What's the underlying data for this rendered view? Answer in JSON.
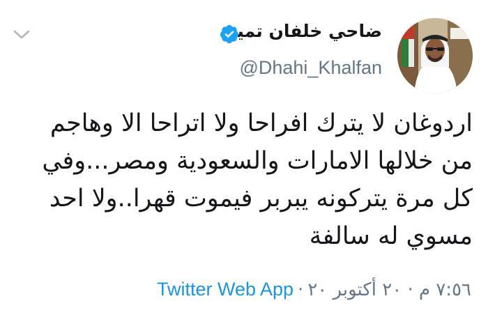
{
  "tweet": {
    "display_name": "ضاحي خلفان تميم",
    "handle": "@Dhahi_Khalfan",
    "text_lines": [
      "اردوغان لا يترك افراحا ولا اتراحا الا وهاجم",
      "من خلالها الامارات والسعودية ومصر...وفي",
      "كل مرة يتركونه يبربر فيموت قهرا..ولا احد",
      "مسوي له سالفة"
    ],
    "timestamp": "٧:٥٦ م · ٢٠ أكتوبر ٢٠",
    "separator": "·",
    "source": "Twitter Web App"
  },
  "colors": {
    "verified": "#1da1f2",
    "secondary_text": "#657786",
    "link": "#1b95e0",
    "chevron": "#aab8c2"
  },
  "icons": {
    "verified": "verified-badge-icon",
    "menu": "chevron-down-icon",
    "avatar": "avatar"
  }
}
